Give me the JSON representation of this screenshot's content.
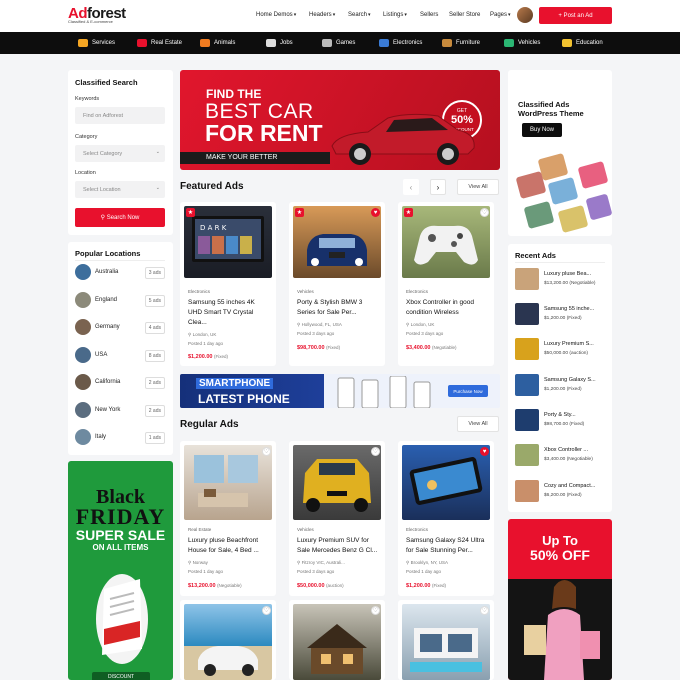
{
  "header": {
    "logo_red": "Ad",
    "logo_dark": "forest",
    "logo_sub": "Classified & E-commerce",
    "nav": [
      "Home Demos",
      "Headers",
      "Search",
      "Listings",
      "Sellers",
      "Seller Store",
      "Pages"
    ],
    "post_ad": "+ Post an Ad"
  },
  "categories": [
    {
      "label": "Services",
      "icon": "services-icon",
      "color": "#f5a623"
    },
    {
      "label": "Real Estate",
      "icon": "real-estate-icon",
      "color": "#e8112d"
    },
    {
      "label": "Animals",
      "icon": "animals-icon",
      "color": "#f07b20"
    },
    {
      "label": "Jobs",
      "icon": "jobs-icon",
      "color": "#ffffff"
    },
    {
      "label": "Games",
      "icon": "games-icon",
      "color": "#cccccc"
    },
    {
      "label": "Electronics",
      "icon": "electronics-icon",
      "color": "#3a7bd5"
    },
    {
      "label": "Furniture",
      "icon": "furniture-icon",
      "color": "#c78a3c"
    },
    {
      "label": "Vehicles",
      "icon": "vehicles-icon",
      "color": "#2bb673"
    },
    {
      "label": "Education",
      "icon": "education-icon",
      "color": "#f2c230"
    }
  ],
  "search": {
    "title": "Classified Search",
    "keywords_label": "Keywords",
    "keywords_placeholder": "Find on Adforest",
    "category_label": "Category",
    "category_value": "Select Category",
    "location_label": "Location",
    "location_value": "Select Location",
    "button": "Search Now"
  },
  "popular": {
    "title": "Popular Locations",
    "items": [
      {
        "name": "Australia",
        "count": "3 ads",
        "color": "#3d6e9c"
      },
      {
        "name": "England",
        "count": "5 ads",
        "color": "#8c8a7a"
      },
      {
        "name": "Germany",
        "count": "4 ads",
        "color": "#7a6350"
      },
      {
        "name": "USA",
        "count": "8 ads",
        "color": "#4a6a8a"
      },
      {
        "name": "California",
        "count": "2 ads",
        "color": "#6b5a4a"
      },
      {
        "name": "New York",
        "count": "2 ads",
        "color": "#5b6d7f"
      },
      {
        "name": "Italy",
        "count": "1 ads",
        "color": "#6e8aa0"
      }
    ]
  },
  "banner_left": {
    "line1": "Black",
    "line2": "FRIDAY",
    "line3": "SUPER SALE",
    "line4": "ON ALL ITEMS",
    "bottom": "DISCOUNT"
  },
  "hero": {
    "line1": "FIND THE",
    "line2": "BEST CAR",
    "line3": "FOR RENT",
    "tagline": "MAKE YOUR BETTER",
    "get": "GET",
    "pct": "50%",
    "disc": "DISCOUNT"
  },
  "featured": {
    "title": "Featured Ads",
    "view_all": "View All",
    "ads": [
      {
        "category": "Electronics",
        "title": "Samsung 55 inches 4K UHD Smart TV Crystal Clea...",
        "location": "London, UK",
        "posted": "Posted 1 day ago",
        "price": "$1,200.00",
        "price_type": "(Fixed)"
      },
      {
        "category": "Vehicles",
        "title": "Porty & Stylish BMW 3 Series for Sale Per...",
        "location": "Hollywood, FL, USA",
        "posted": "Posted 3 days ago",
        "price": "$98,700.00",
        "price_type": "(Fixed)"
      },
      {
        "category": "Electronics",
        "title": "Xbox Controller in good condition Wireless",
        "location": "London, UK",
        "posted": "Posted 3 days ago",
        "price": "$3,400.00",
        "price_type": "(Negotiable)"
      }
    ]
  },
  "promo": {
    "line1": "SMARTPHONE",
    "line2": "LATEST PHONE",
    "button": "Purchase Now"
  },
  "regular": {
    "title": "Regular Ads",
    "view_all": "View All",
    "ads": [
      {
        "category": "Real Estate",
        "title": "Luxury pluse Beachfront House for Sale, 4 Bed ...",
        "location": "Norway",
        "posted": "Posted 1 day ago",
        "price": "$13,200.00",
        "price_type": "(Negotiable)"
      },
      {
        "category": "Vehicles",
        "title": "Luxury Premium SUV for Sale Mercedes Benz G Cl...",
        "location": "Fitzroy VIC, Australi...",
        "posted": "Posted 3 days ago",
        "price": "$50,000.00",
        "price_type": "(auction)"
      },
      {
        "category": "Electronics",
        "title": "Samsung Galaxy S24 Ultra for Sale Stunning Per...",
        "location": "Brooklyn, NY, USA",
        "posted": "Posted 1 day ago",
        "price": "$1,200.00",
        "price_type": "(Fixed)"
      }
    ]
  },
  "theme": {
    "title": "Classified Ads WordPress Theme",
    "button": "Buy Now"
  },
  "recent": {
    "title": "Recent Ads",
    "items": [
      {
        "title": "Luxury pluse Bea...",
        "price": "$13,200.00",
        "type": "(Negotiable)",
        "color": "#c9a37a"
      },
      {
        "title": "Samsung 55 inche...",
        "price": "$1,200.00",
        "type": "(Fixed)",
        "color": "#2a3550"
      },
      {
        "title": "Luxury Premium S...",
        "price": "$50,000.00",
        "type": "(auction)",
        "color": "#d8a21c"
      },
      {
        "title": "Samsung Galaxy S...",
        "price": "$1,200.00",
        "type": "(Fixed)",
        "color": "#2d5fa0"
      },
      {
        "title": "Porty & Sty...",
        "price": "$98,700.00",
        "type": "(Fixed)",
        "color": "#1e3d6e"
      },
      {
        "title": "Xbox Controller ...",
        "price": "$3,400.00",
        "type": "(Negotiable)",
        "color": "#9aa96a"
      },
      {
        "title": "Cozy and Compact...",
        "price": "$6,200.00",
        "type": "(Fixed)",
        "color": "#c98f6a"
      }
    ]
  },
  "banner_right": {
    "line1": "Up To",
    "line2": "50% OFF"
  }
}
